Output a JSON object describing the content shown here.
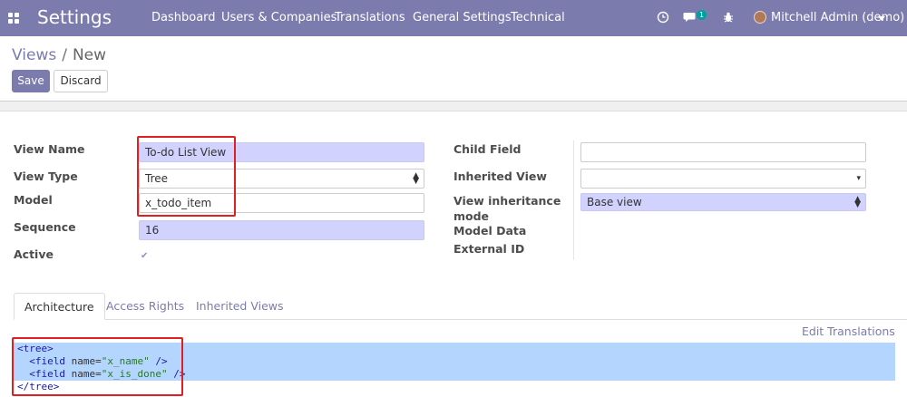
{
  "navbar": {
    "brand": "Settings",
    "menu": [
      "Dashboard",
      "Users & Companies",
      "Translations",
      "General Settings",
      "Technical"
    ],
    "chat_badge": "1",
    "user": "Mitchell Admin (demo)"
  },
  "breadcrumb": {
    "parent": "Views",
    "current": "New"
  },
  "buttons": {
    "save": "Save",
    "discard": "Discard"
  },
  "form_left": {
    "view_name_label": "View Name",
    "view_name_value": "To-do List View",
    "view_type_label": "View Type",
    "view_type_value": "Tree",
    "model_label": "Model",
    "model_value": "x_todo_item",
    "sequence_label": "Sequence",
    "sequence_value": "16",
    "active_label": "Active",
    "active_checked": true
  },
  "form_right": {
    "child_field_label": "Child Field",
    "child_field_value": "",
    "inherited_view_label": "Inherited View",
    "inherited_view_value": "",
    "inheritance_mode_label_1": "View inheritance",
    "inheritance_mode_label_2": "mode",
    "inheritance_mode_value": "Base view",
    "model_data_label": "Model Data",
    "external_id_label": "External ID"
  },
  "tabs": [
    "Architecture",
    "Access Rights",
    "Inherited Views"
  ],
  "edit_translations": "Edit Translations",
  "code": {
    "line1_open": "<tree>",
    "line2_tag": "<field ",
    "line2_attr": "name=",
    "line2_val": "\"x_name\"",
    "line2_end": " />",
    "line3_tag": "<field ",
    "line3_attr": "name=",
    "line3_val": "\"x_is_done\"",
    "line3_end": " />",
    "line4_close": "</tree>"
  },
  "colors": {
    "navbar": "#7c7bad",
    "required_field": "#d2d2ff",
    "highlight_box": "#e02020",
    "code_selection": "#b4d5fe"
  }
}
